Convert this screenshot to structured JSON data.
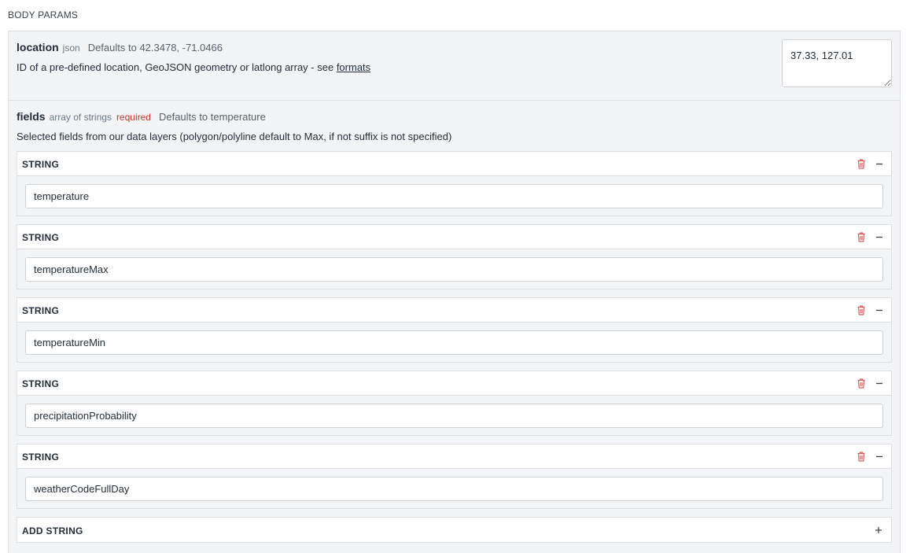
{
  "section_title": "BODY PARAMS",
  "location": {
    "name": "location",
    "type": "json",
    "default": "Defaults to 42.3478, -71.0466",
    "description": "ID of a pre-defined location, GeoJSON geometry or latlong array - see ",
    "link_text": "formats",
    "value": "37.33, 127.01"
  },
  "fields": {
    "name": "fields",
    "type": "array of strings",
    "required": "required",
    "default": "Defaults to temperature",
    "description": "Selected fields from our data layers (polygon/polyline default to Max, if not suffix is not specified)",
    "items": [
      {
        "label": "STRING",
        "value": "temperature"
      },
      {
        "label": "STRING",
        "value": "temperatureMax"
      },
      {
        "label": "STRING",
        "value": "temperatureMin"
      },
      {
        "label": "STRING",
        "value": "precipitationProbability"
      },
      {
        "label": "STRING",
        "value": "weatherCodeFullDay"
      }
    ],
    "add_label": "ADD STRING"
  },
  "colors": {
    "required": "#c0392b",
    "trash": "#e05a5a"
  },
  "icons": {
    "delete": "trash-icon",
    "collapse": "minus-icon",
    "add": "plus-icon"
  }
}
